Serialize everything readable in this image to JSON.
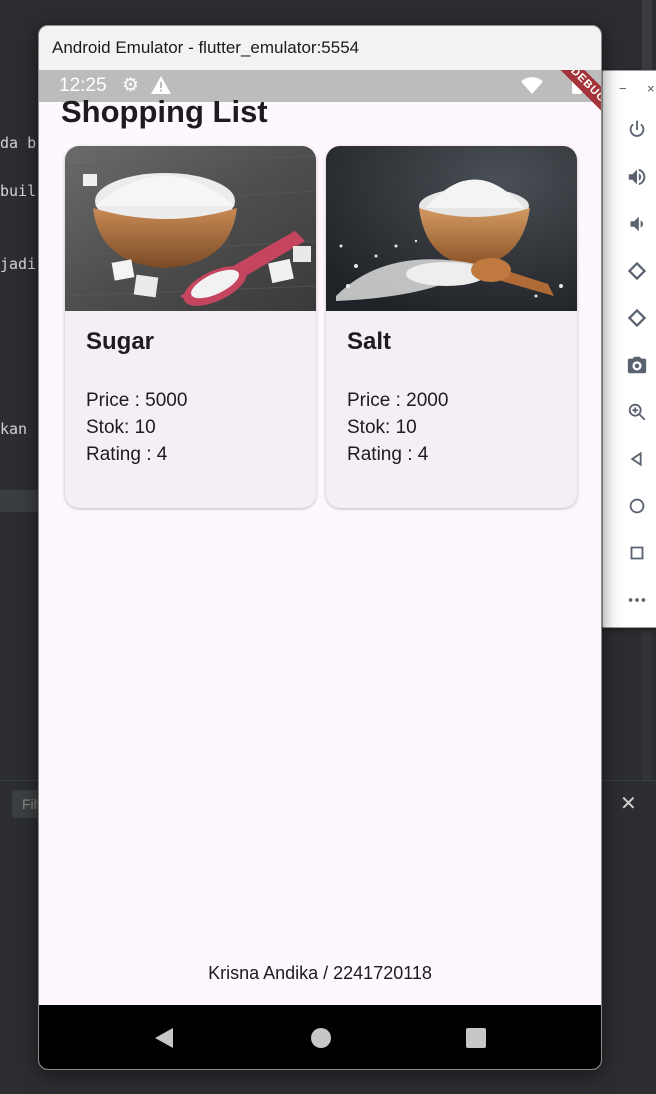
{
  "ide": {
    "code_fragments": [
      "da b",
      "buil",
      "jadi",
      "kan"
    ],
    "filter_placeholder": "Filt",
    "close_symbol": "✕",
    "caret_symbol": "^"
  },
  "emulator_toolbar": {
    "minimize_symbol": "−",
    "close_symbol": "×",
    "buttons": [
      {
        "name": "power-icon"
      },
      {
        "name": "volume-up-icon"
      },
      {
        "name": "volume-down-icon"
      },
      {
        "name": "rotate-left-icon"
      },
      {
        "name": "rotate-right-icon"
      },
      {
        "name": "camera-icon"
      },
      {
        "name": "zoom-icon"
      },
      {
        "name": "back-icon"
      },
      {
        "name": "home-icon"
      },
      {
        "name": "overview-icon"
      },
      {
        "name": "more-icon"
      }
    ]
  },
  "emulator": {
    "title": "Android Emulator - flutter_emulator:5554"
  },
  "status_bar": {
    "time": "12:25",
    "debug_label": "DEBUG"
  },
  "app": {
    "title": "Shopping List",
    "products": [
      {
        "name": "Sugar",
        "price": "Price : 5000",
        "stock": "Stok: 10",
        "rating": "Rating : 4",
        "image_theme": "sugar-bowl"
      },
      {
        "name": "Salt",
        "price": "Price : 2000",
        "stock": "Stok: 10",
        "rating": "Rating : 4",
        "image_theme": "salt-bowl"
      }
    ],
    "footer": "Krisna Andika / 2241720118"
  },
  "colors": {
    "app_background": "#fef7fd",
    "card_background": "#f4eff7",
    "status_bar": "#bcbcbc",
    "debug_banner": "#a4343a",
    "nav_bar": "#000000"
  }
}
